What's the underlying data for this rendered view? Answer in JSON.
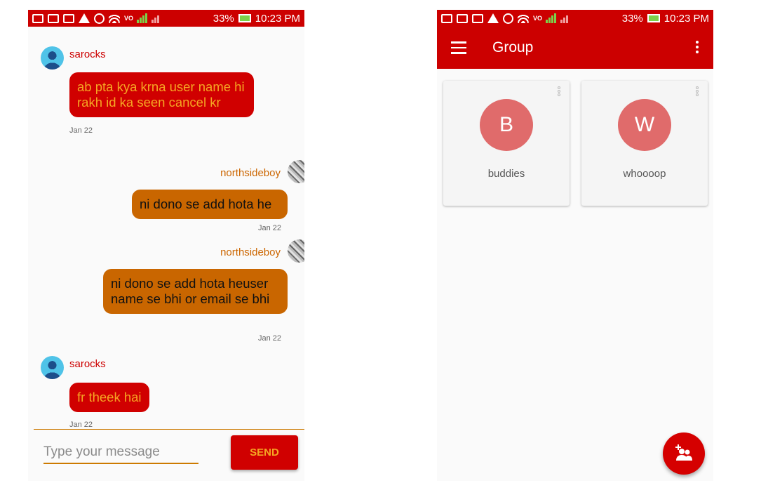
{
  "status_bar": {
    "battery": "33%",
    "time": "10:23 PM"
  },
  "chat": {
    "messages": [
      {
        "sender": "sarocks",
        "text": "ab pta kya krna user name hi rakh id ka seen cancel kr",
        "date": "Jan 22",
        "side": "left"
      },
      {
        "sender": "northsideboy",
        "text": "ni dono se add hota he",
        "date": "Jan 22",
        "side": "right"
      },
      {
        "sender": "northsideboy",
        "text": "ni dono se add hota heuser name se bhi or email se bhi",
        "date": "Jan 22",
        "side": "right"
      },
      {
        "sender": "sarocks",
        "text": "fr theek hai",
        "date": "Jan 22",
        "side": "left"
      }
    ],
    "composer": {
      "placeholder": "Type your message",
      "send_label": "SEND"
    }
  },
  "groups_screen": {
    "title": "Group",
    "groups": [
      {
        "initial": "B",
        "name": "buddies"
      },
      {
        "initial": "W",
        "name": "whoooop"
      }
    ],
    "fab_icon": "add-group-icon"
  },
  "colors": {
    "primary": "#cc0000",
    "accent_text": "#f5a623",
    "outgoing_bubble": "#c96600",
    "group_avatar": "#e06b6b"
  }
}
